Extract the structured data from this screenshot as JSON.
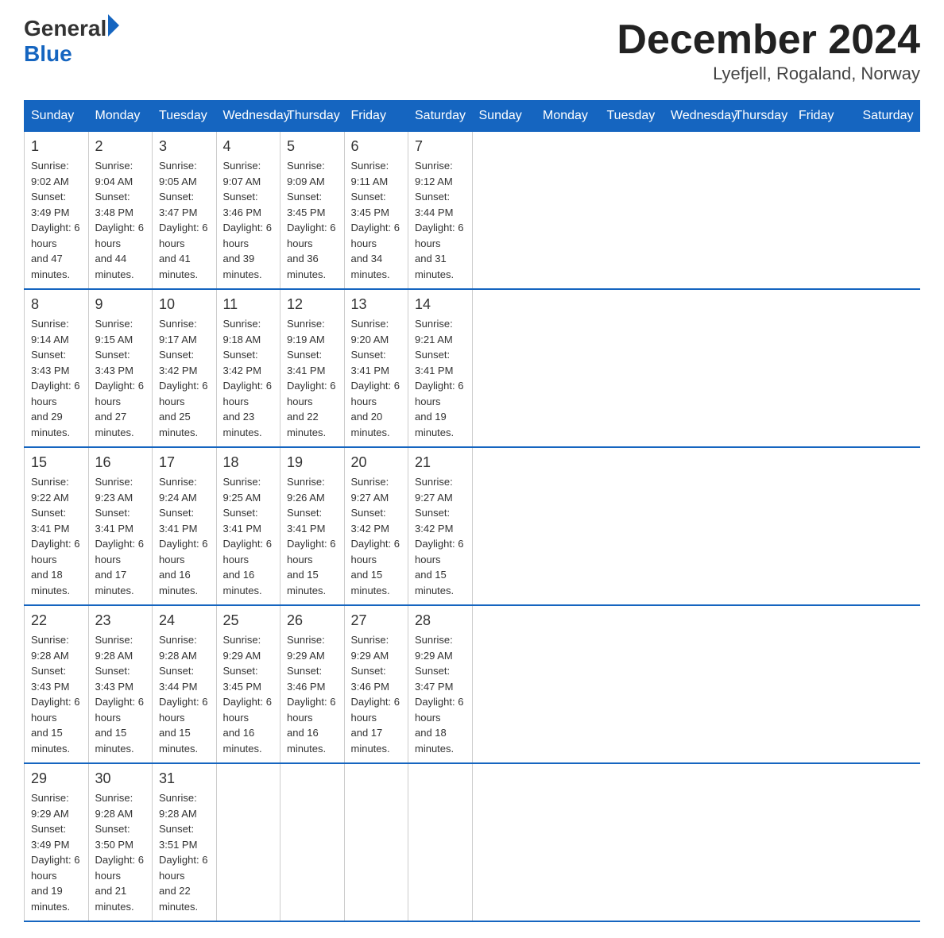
{
  "logo": {
    "text_general": "General",
    "text_blue": "Blue"
  },
  "title": "December 2024",
  "subtitle": "Lyefjell, Rogaland, Norway",
  "days_of_week": [
    "Sunday",
    "Monday",
    "Tuesday",
    "Wednesday",
    "Thursday",
    "Friday",
    "Saturday"
  ],
  "weeks": [
    [
      {
        "day": "1",
        "sunrise": "9:02 AM",
        "sunset": "3:49 PM",
        "daylight": "6 hours and 47 minutes."
      },
      {
        "day": "2",
        "sunrise": "9:04 AM",
        "sunset": "3:48 PM",
        "daylight": "6 hours and 44 minutes."
      },
      {
        "day": "3",
        "sunrise": "9:05 AM",
        "sunset": "3:47 PM",
        "daylight": "6 hours and 41 minutes."
      },
      {
        "day": "4",
        "sunrise": "9:07 AM",
        "sunset": "3:46 PM",
        "daylight": "6 hours and 39 minutes."
      },
      {
        "day": "5",
        "sunrise": "9:09 AM",
        "sunset": "3:45 PM",
        "daylight": "6 hours and 36 minutes."
      },
      {
        "day": "6",
        "sunrise": "9:11 AM",
        "sunset": "3:45 PM",
        "daylight": "6 hours and 34 minutes."
      },
      {
        "day": "7",
        "sunrise": "9:12 AM",
        "sunset": "3:44 PM",
        "daylight": "6 hours and 31 minutes."
      }
    ],
    [
      {
        "day": "8",
        "sunrise": "9:14 AM",
        "sunset": "3:43 PM",
        "daylight": "6 hours and 29 minutes."
      },
      {
        "day": "9",
        "sunrise": "9:15 AM",
        "sunset": "3:43 PM",
        "daylight": "6 hours and 27 minutes."
      },
      {
        "day": "10",
        "sunrise": "9:17 AM",
        "sunset": "3:42 PM",
        "daylight": "6 hours and 25 minutes."
      },
      {
        "day": "11",
        "sunrise": "9:18 AM",
        "sunset": "3:42 PM",
        "daylight": "6 hours and 23 minutes."
      },
      {
        "day": "12",
        "sunrise": "9:19 AM",
        "sunset": "3:41 PM",
        "daylight": "6 hours and 22 minutes."
      },
      {
        "day": "13",
        "sunrise": "9:20 AM",
        "sunset": "3:41 PM",
        "daylight": "6 hours and 20 minutes."
      },
      {
        "day": "14",
        "sunrise": "9:21 AM",
        "sunset": "3:41 PM",
        "daylight": "6 hours and 19 minutes."
      }
    ],
    [
      {
        "day": "15",
        "sunrise": "9:22 AM",
        "sunset": "3:41 PM",
        "daylight": "6 hours and 18 minutes."
      },
      {
        "day": "16",
        "sunrise": "9:23 AM",
        "sunset": "3:41 PM",
        "daylight": "6 hours and 17 minutes."
      },
      {
        "day": "17",
        "sunrise": "9:24 AM",
        "sunset": "3:41 PM",
        "daylight": "6 hours and 16 minutes."
      },
      {
        "day": "18",
        "sunrise": "9:25 AM",
        "sunset": "3:41 PM",
        "daylight": "6 hours and 16 minutes."
      },
      {
        "day": "19",
        "sunrise": "9:26 AM",
        "sunset": "3:41 PM",
        "daylight": "6 hours and 15 minutes."
      },
      {
        "day": "20",
        "sunrise": "9:27 AM",
        "sunset": "3:42 PM",
        "daylight": "6 hours and 15 minutes."
      },
      {
        "day": "21",
        "sunrise": "9:27 AM",
        "sunset": "3:42 PM",
        "daylight": "6 hours and 15 minutes."
      }
    ],
    [
      {
        "day": "22",
        "sunrise": "9:28 AM",
        "sunset": "3:43 PM",
        "daylight": "6 hours and 15 minutes."
      },
      {
        "day": "23",
        "sunrise": "9:28 AM",
        "sunset": "3:43 PM",
        "daylight": "6 hours and 15 minutes."
      },
      {
        "day": "24",
        "sunrise": "9:28 AM",
        "sunset": "3:44 PM",
        "daylight": "6 hours and 15 minutes."
      },
      {
        "day": "25",
        "sunrise": "9:29 AM",
        "sunset": "3:45 PM",
        "daylight": "6 hours and 16 minutes."
      },
      {
        "day": "26",
        "sunrise": "9:29 AM",
        "sunset": "3:46 PM",
        "daylight": "6 hours and 16 minutes."
      },
      {
        "day": "27",
        "sunrise": "9:29 AM",
        "sunset": "3:46 PM",
        "daylight": "6 hours and 17 minutes."
      },
      {
        "day": "28",
        "sunrise": "9:29 AM",
        "sunset": "3:47 PM",
        "daylight": "6 hours and 18 minutes."
      }
    ],
    [
      {
        "day": "29",
        "sunrise": "9:29 AM",
        "sunset": "3:49 PM",
        "daylight": "6 hours and 19 minutes."
      },
      {
        "day": "30",
        "sunrise": "9:28 AM",
        "sunset": "3:50 PM",
        "daylight": "6 hours and 21 minutes."
      },
      {
        "day": "31",
        "sunrise": "9:28 AM",
        "sunset": "3:51 PM",
        "daylight": "6 hours and 22 minutes."
      },
      null,
      null,
      null,
      null
    ]
  ],
  "labels": {
    "sunrise": "Sunrise:",
    "sunset": "Sunset:",
    "daylight": "Daylight:"
  }
}
